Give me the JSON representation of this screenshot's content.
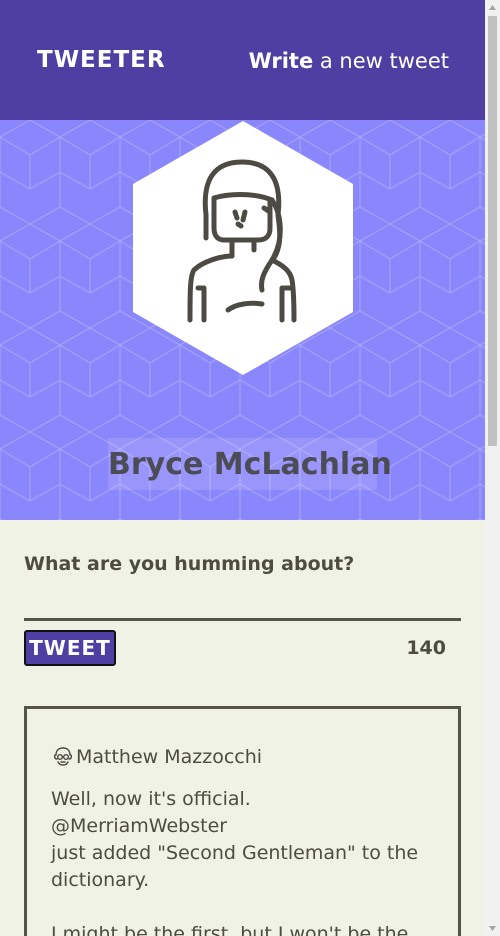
{
  "nav": {
    "brand": "TWEETER",
    "write_bold": "Write",
    "write_rest": " a new tweet"
  },
  "profile": {
    "name": "Bryce McLachlan",
    "avatar_icon": "woman-avatar-icon"
  },
  "compose": {
    "prompt": "What are you humming about?",
    "input_value": "",
    "button_label": "TWEET",
    "counter": "140"
  },
  "tweets": [
    {
      "author": "Matthew Mazzocchi",
      "avatar_icon": "old-man-avatar-icon",
      "lines": [
        "Well, now it's official.",
        "@MerriamWebster",
        "just added \"Second Gentleman\" to the",
        "dictionary.",
        "",
        "I might be the first, but I won't be the"
      ]
    }
  ],
  "colors": {
    "nav_bg": "#4f3fa3",
    "profile_bg": "#8a86fb",
    "page_bg": "#f1f2e6",
    "text": "#4c4c42",
    "button_bg": "#4f3fa3"
  }
}
